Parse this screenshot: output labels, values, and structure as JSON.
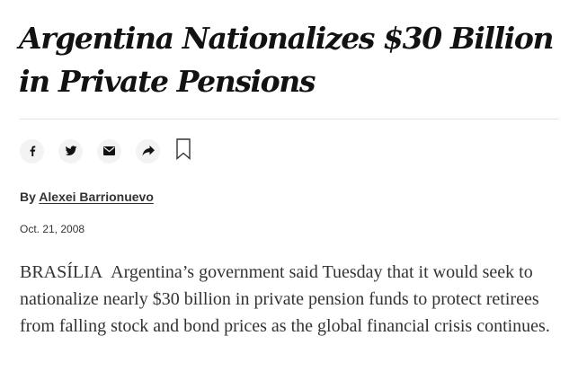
{
  "article": {
    "headline": "Argentina Nationalizes $30 Billion in Private Pensions",
    "byline_prefix": "By",
    "author": "Alexei Barrionuevo",
    "date": "Oct. 21, 2008",
    "lede_location": "BRASÍLIA",
    "lede_text": "Argentina’s government said Tuesday that it would seek to nationalize nearly $30 billion in private pension funds to protect retirees from falling stock and bond prices as the global financial crisis continues."
  },
  "share_bar": {
    "buttons": [
      {
        "name": "facebook",
        "icon": "facebook-icon"
      },
      {
        "name": "twitter",
        "icon": "twitter-icon"
      },
      {
        "name": "email",
        "icon": "email-icon"
      },
      {
        "name": "share",
        "icon": "share-icon"
      }
    ],
    "save_icon": "bookmark-icon"
  },
  "colors": {
    "text": "#121212",
    "body_text": "#333333",
    "button_bg": "#f3f3f3",
    "rule": "#e2e2e2"
  }
}
